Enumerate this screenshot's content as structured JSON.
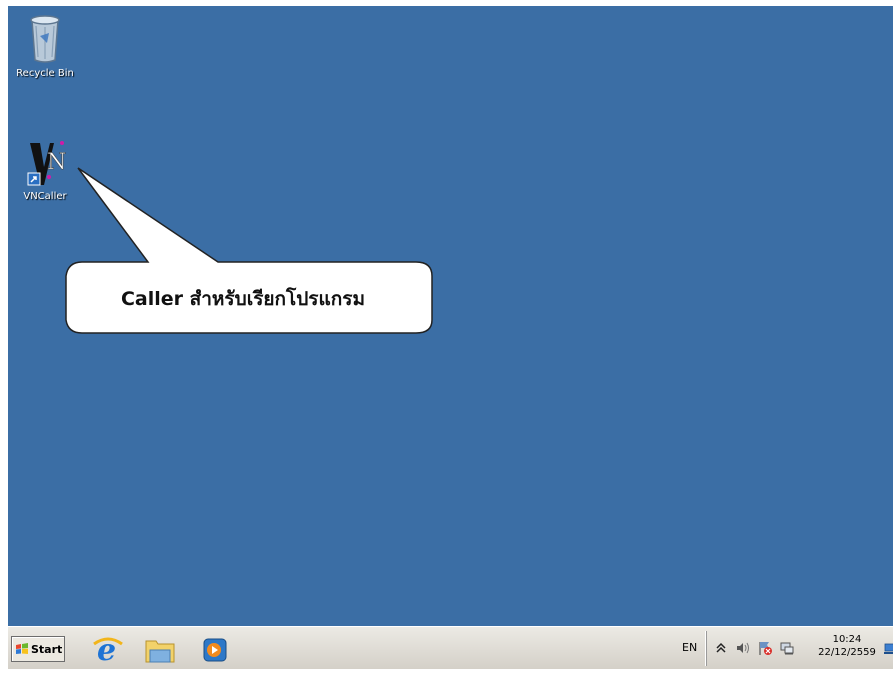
{
  "desktop": {
    "background_color": "#3b6ea5",
    "icons": [
      {
        "label": "Recycle Bin",
        "icon": "recycle-bin-icon"
      },
      {
        "label": "VNCaller",
        "icon": "vncaller-icon"
      }
    ]
  },
  "callout": {
    "text": "Caller สำหรับเรียกโปรแกรม"
  },
  "taskbar": {
    "start_label": "Start",
    "pinned": [
      {
        "icon": "internet-explorer-icon"
      },
      {
        "icon": "file-explorer-icon"
      },
      {
        "icon": "media-player-icon"
      }
    ],
    "language": "EN",
    "tray_icons": [
      "show-hidden-icons-chevron-icon",
      "volume-icon",
      "action-center-flag-icon",
      "network-icon"
    ],
    "clock_time": "10:24",
    "clock_date": "22/12/2559"
  }
}
